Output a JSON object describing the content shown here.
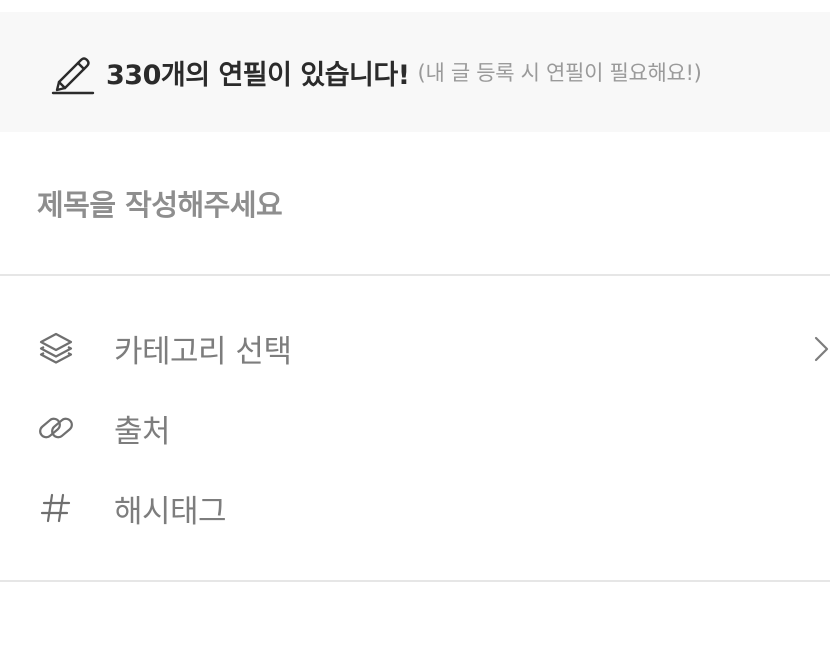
{
  "banner": {
    "icon": "pencil-icon",
    "main_text": "330개의 연필이 있습니다!",
    "sub_text": "(내 글 등록 시 연필이 필요해요!)"
  },
  "title_field": {
    "placeholder": "제목을 작성해주세요",
    "value": ""
  },
  "menu": {
    "items": [
      {
        "icon": "layers-icon",
        "label": "카테고리 선택",
        "has_chevron": true
      },
      {
        "icon": "link-icon",
        "label": "출처",
        "has_chevron": false
      },
      {
        "icon": "hashtag-icon",
        "label": "해시태그",
        "has_chevron": false
      }
    ]
  },
  "colors": {
    "banner_bg": "#f8f8f8",
    "divider": "#e6e6e6",
    "label_gray": "#7d7d7d",
    "icon_gray": "#6f6f6f"
  }
}
